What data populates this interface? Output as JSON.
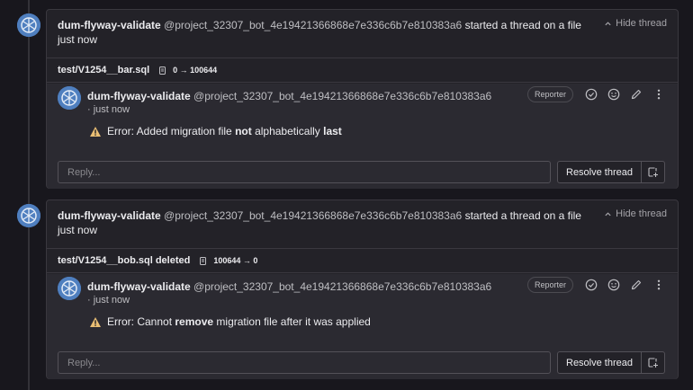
{
  "colors": {
    "background": "#18171d",
    "card": "#232228",
    "note": "#2b2a31",
    "warning": "#e9be74",
    "avatar": "#4f7fbf"
  },
  "threads": [
    {
      "author_name": "dum-flyway-validate",
      "author_handle": "@project_32307_bot_4e19421366868e7e336c6b7e810383a6",
      "action_text": "started a thread on a file",
      "time": "just now",
      "hide_label": "Hide thread",
      "file": {
        "name": "test/V1254__bar.sql",
        "mode_change": "0 → 100644",
        "icon": "file-mode-icon"
      },
      "note": {
        "author_name": "dum-flyway-validate",
        "author_handle": "@project_32307_bot_4e19421366868e7e336c6b7e810383a6",
        "time": "· just now",
        "role_badge": "Reporter",
        "message_parts": [
          "Error: Added migration file ",
          "not",
          " alphabetically ",
          "last"
        ]
      },
      "reply_placeholder": "Reply...",
      "resolve_label": "Resolve thread"
    },
    {
      "author_name": "dum-flyway-validate",
      "author_handle": "@project_32307_bot_4e19421366868e7e336c6b7e810383a6",
      "action_text": "started a thread on a file",
      "time": "just now",
      "hide_label": "Hide thread",
      "file": {
        "name": "test/V1254__bob.sql deleted",
        "mode_change": "100644 → 0",
        "icon": "file-mode-icon"
      },
      "note": {
        "author_name": "dum-flyway-validate",
        "author_handle": "@project_32307_bot_4e19421366868e7e336c6b7e810383a6",
        "time": "· just now",
        "role_badge": "Reporter",
        "message_parts": [
          "Error: Cannot ",
          "remove",
          " migration file after it was applied",
          ""
        ]
      },
      "reply_placeholder": "Reply...",
      "resolve_label": "Resolve thread"
    }
  ]
}
